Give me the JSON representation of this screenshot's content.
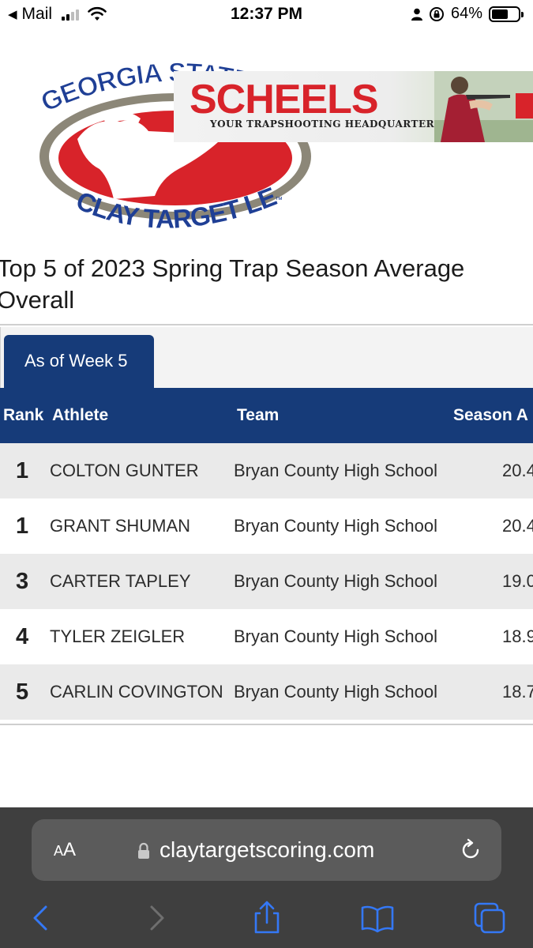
{
  "status_bar": {
    "back_app": "Mail",
    "time": "12:37 PM",
    "battery": "64%",
    "battery_level": 0.64
  },
  "logo": {
    "top_text": "GEORGIA STATE HIGH",
    "bottom_text": "CLAY TARGET LEAGUE",
    "mark": "™"
  },
  "ad": {
    "brand": "SCHEELS",
    "tagline": "YOUR TRAPSHOOTING HEADQUARTERS"
  },
  "page": {
    "title": "Top 5 of 2023 Spring Trap Season Average Overall"
  },
  "tabs": [
    {
      "label": "As of Week 5",
      "active": true
    }
  ],
  "table": {
    "headers": {
      "rank": "Rank",
      "athlete": "Athlete",
      "team": "Team",
      "season_avg": "Season A"
    },
    "rows": [
      {
        "rank": "1",
        "athlete": "COLTON GUNTER",
        "team": "Bryan County High School",
        "avg": "20.4"
      },
      {
        "rank": "1",
        "athlete": "GRANT SHUMAN",
        "team": "Bryan County High School",
        "avg": "20.4"
      },
      {
        "rank": "3",
        "athlete": "CARTER TAPLEY",
        "team": "Bryan County High School",
        "avg": "19.0"
      },
      {
        "rank": "4",
        "athlete": "TYLER ZEIGLER",
        "team": "Bryan County High School",
        "avg": "18.9"
      },
      {
        "rank": "5",
        "athlete": "CARLIN COVINGTON",
        "team": "Bryan County High School",
        "avg": "18.7"
      }
    ]
  },
  "browser": {
    "aa_label_small": "A",
    "aa_label_large": "A",
    "url": "claytargetscoring.com"
  },
  "colors": {
    "navy": "#163b79",
    "brand_red": "#d8232a",
    "toolbar_blue": "#3478f6"
  }
}
